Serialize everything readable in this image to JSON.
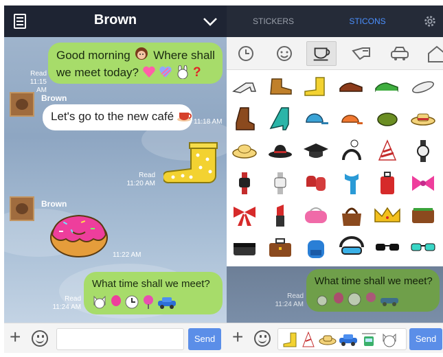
{
  "header": {
    "title": "Brown"
  },
  "tabs": [
    {
      "label": "STICKERS",
      "active": false
    },
    {
      "label": "STICONS",
      "active": true
    }
  ],
  "messages": [
    {
      "text": "Good morning",
      "text2": "Where shall",
      "line2": "we meet today?",
      "status": "Read",
      "time": "11:15 AM"
    },
    {
      "sender": "Brown",
      "text": "Let's go to the new café",
      "time": "11:18 AM"
    },
    {
      "status": "Read",
      "time": "11:20 AM"
    },
    {
      "sender": "Brown",
      "time": "11:22 AM"
    },
    {
      "text": "What time shall we meet?",
      "status": "Read",
      "time": "11:24 AM"
    }
  ],
  "input": {
    "send_label": "Send"
  },
  "preview": {
    "text": "What time shall we meet?",
    "status": "Read",
    "time": "11:24 AM"
  },
  "colors": {
    "accent": "#4b90ff",
    "bubble": "#a7dc6a",
    "header": "#1e2433",
    "send": "#5b8ee8"
  },
  "categories": [
    "clock-icon",
    "smiley-icon",
    "cup-icon",
    "hand-icon",
    "car-icon",
    "house-icon"
  ],
  "sticon_grid": [
    [
      "high-heel",
      "work-boot",
      "rain-boot",
      "dress-shoe",
      "sneaker",
      "flip-flop"
    ],
    [
      "cowboy-boot",
      "teal-heel",
      "cap",
      "orange-cap",
      "green-cap",
      "straw-hat"
    ],
    [
      "sun-hat",
      "fedora",
      "graduation-cap",
      "headband",
      "party-hat",
      "wristwatch"
    ],
    [
      "red-watch",
      "silver-watch",
      "gloves",
      "scarf",
      "suitcase",
      "pink-bow"
    ],
    [
      "red-bow",
      "lipstick",
      "pink-purse",
      "handbag",
      "crown",
      "wallet"
    ],
    [
      "clutch",
      "briefcase",
      "backpack",
      "goggles",
      "sunglasses",
      "teal-glasses"
    ]
  ]
}
